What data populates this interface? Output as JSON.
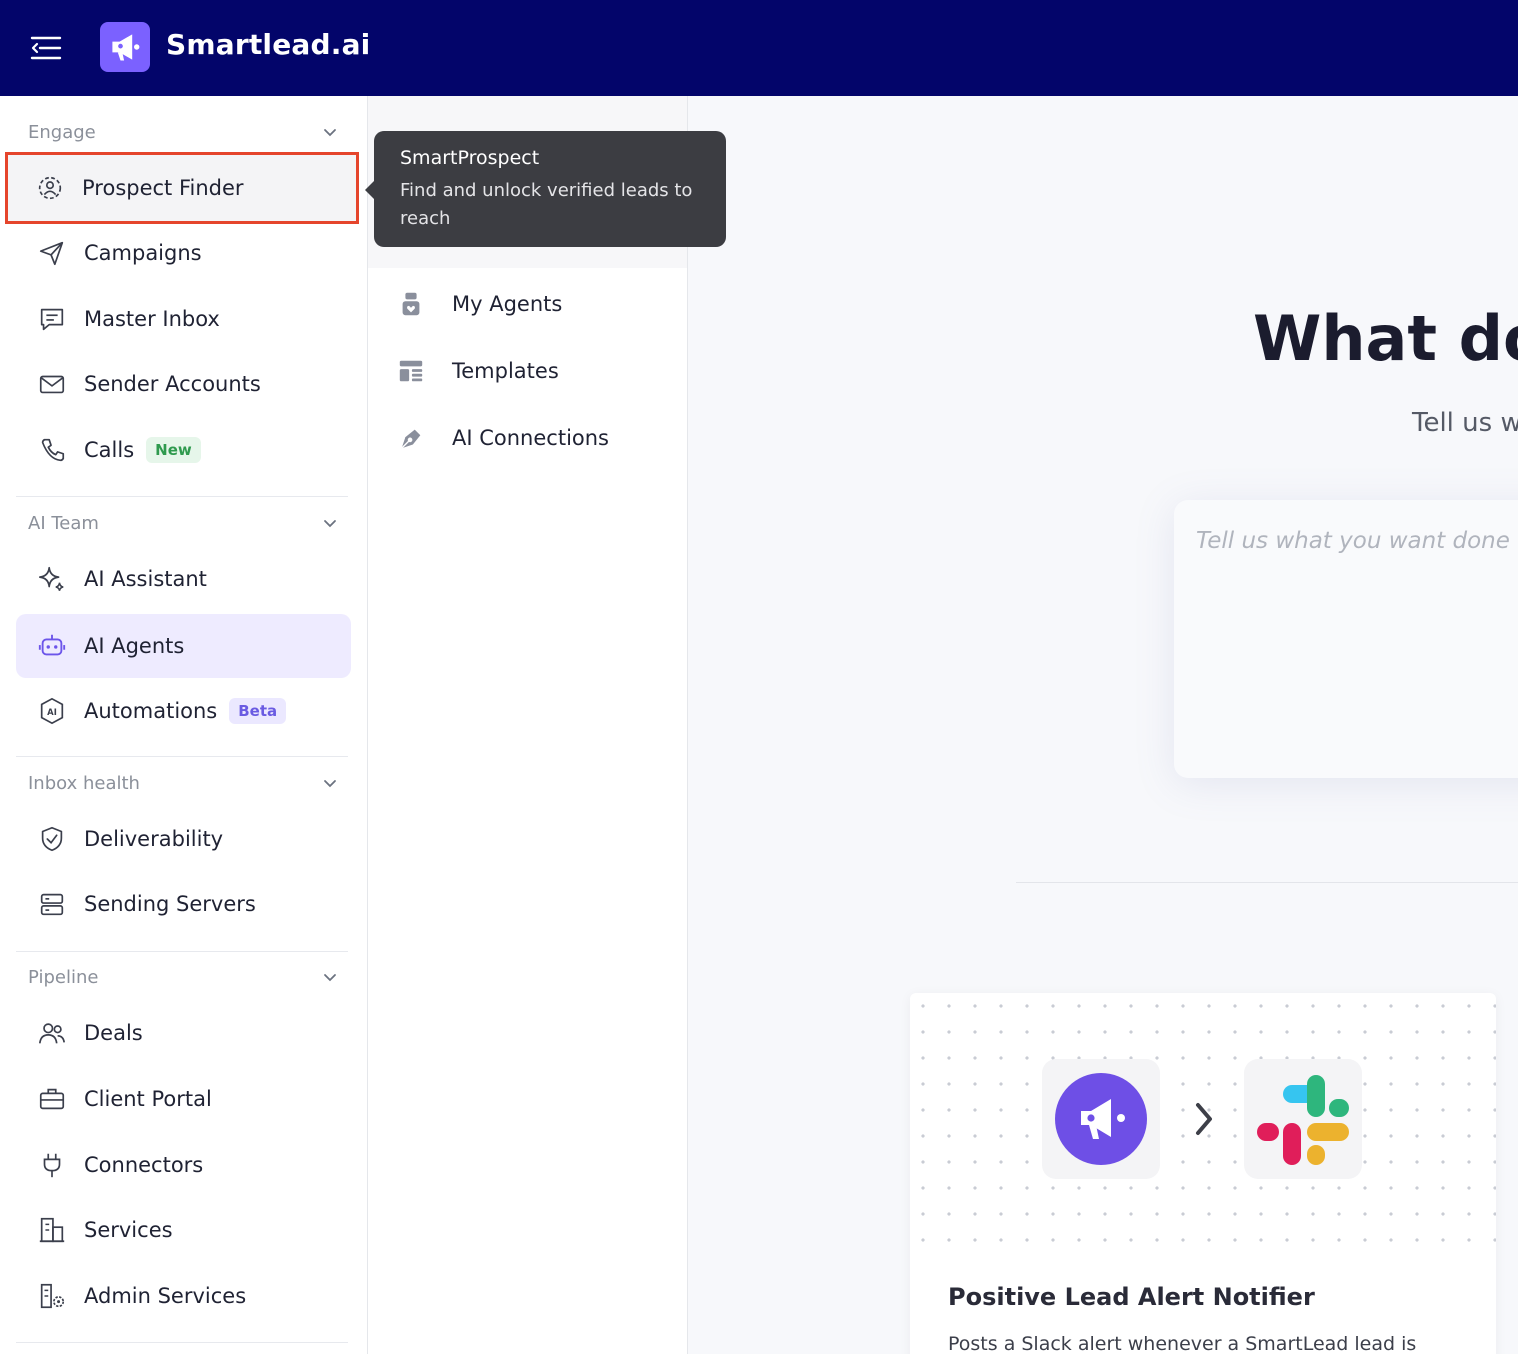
{
  "header": {
    "brand": "Smartlead.ai",
    "brand_color": "#03056a",
    "logo_color": "#7b61ff"
  },
  "sidebar": {
    "sections": [
      {
        "title": "Engage",
        "items": [
          {
            "label": "Prospect Finder",
            "icon": "gear-users-icon"
          },
          {
            "label": "Campaigns",
            "icon": "send-icon"
          },
          {
            "label": "Master Inbox",
            "icon": "chat-icon"
          },
          {
            "label": "Sender Accounts",
            "icon": "mail-icon"
          },
          {
            "label": "Calls",
            "icon": "phone-icon",
            "badge": "New"
          }
        ]
      },
      {
        "title": "AI Team",
        "items": [
          {
            "label": "AI Assistant",
            "icon": "sparkle-icon"
          },
          {
            "label": "AI Agents",
            "icon": "robot-icon",
            "active": true
          },
          {
            "label": "Automations",
            "icon": "ai-chip-icon",
            "badge": "Beta"
          }
        ]
      },
      {
        "title": "Inbox health",
        "items": [
          {
            "label": "Deliverability",
            "icon": "shield-check-icon"
          },
          {
            "label": "Sending Servers",
            "icon": "server-icon"
          }
        ]
      },
      {
        "title": "Pipeline",
        "items": [
          {
            "label": "Deals",
            "icon": "users-icon"
          },
          {
            "label": "Client Portal",
            "icon": "briefcase-icon"
          },
          {
            "label": "Connectors",
            "icon": "plug-icon"
          },
          {
            "label": "Services",
            "icon": "building-icon"
          },
          {
            "label": "Admin Services",
            "icon": "building-gear-icon"
          }
        ]
      }
    ]
  },
  "subpanel": {
    "items": [
      {
        "label": "My Agents",
        "icon": "agent-icon"
      },
      {
        "label": "Templates",
        "icon": "template-icon"
      },
      {
        "label": "AI Connections",
        "icon": "pen-nib-icon"
      }
    ]
  },
  "tooltip": {
    "title": "SmartProspect",
    "body": "Find and unlock verified leads to reach"
  },
  "main": {
    "hero_title": "What do",
    "hero_sub": "Tell us w",
    "prompt_placeholder": "Tell us what you want done",
    "card": {
      "title": "Positive Lead Alert Notifier",
      "description": "Posts a Slack alert whenever a SmartLead lead is"
    }
  }
}
